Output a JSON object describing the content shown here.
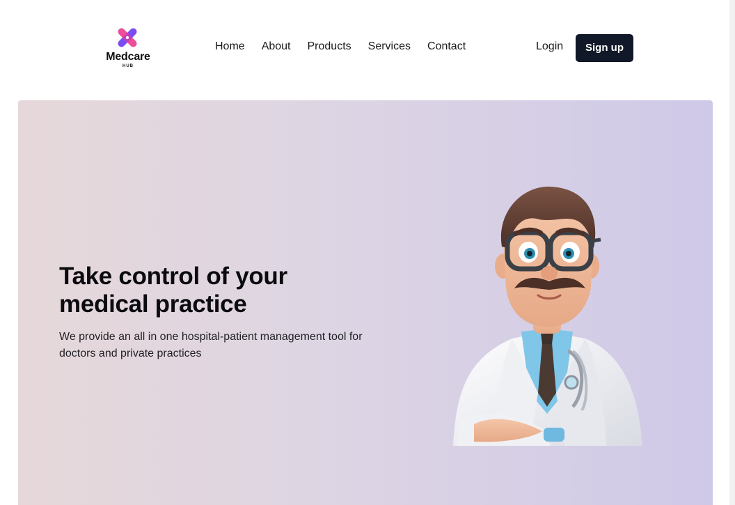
{
  "brand": {
    "name": "Medcare",
    "sub": "HUB",
    "colors": {
      "pink": "#ec3f8e",
      "purple": "#7b4cf0",
      "dark": "#111827"
    }
  },
  "nav": {
    "items": [
      {
        "label": "Home"
      },
      {
        "label": "About"
      },
      {
        "label": "Products"
      },
      {
        "label": "Services"
      },
      {
        "label": "Contact"
      }
    ]
  },
  "auth": {
    "login_label": "Login",
    "signup_label": "Sign up"
  },
  "hero": {
    "title": "Take control of your medical practice",
    "description": "We provide an all in one hospital-patient management tool for doctors and private practices",
    "illustration": "doctor-illustration"
  }
}
